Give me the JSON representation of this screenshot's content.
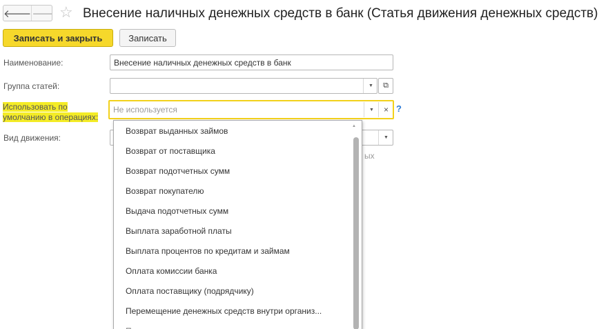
{
  "header": {
    "back_icon": "arrow-left-icon",
    "forward_icon": "arrow-right-icon",
    "favorite_icon": "star-icon",
    "title": "Внесение наличных денежных средств в банк (Статья движения денежных средств)"
  },
  "toolbar": {
    "save_close_label": "Записать и закрыть",
    "save_label": "Записать"
  },
  "form": {
    "name_label": "Наименование:",
    "name_value": "Внесение наличных денежных средств в банк",
    "group_label": "Группа статей:",
    "group_value": "",
    "default_label_line1": "Использовать по",
    "default_label_line2": "умолчанию в операциях:",
    "default_placeholder": "Не используется",
    "clear_icon_glyph": "×",
    "help_glyph": "?",
    "movement_label": "Вид движения:"
  },
  "dropdown": {
    "items": [
      "Возврат выданных займов",
      "Возврат от поставщика",
      "Возврат подотчетных сумм",
      "Возврат покупателю",
      "Выдача подотчетных сумм",
      "Выплата заработной платы",
      "Выплата процентов по кредитам и займам",
      "Оплата комиссии банка",
      "Оплата поставщику (подрядчику)",
      "Перемещение денежных средств внутри организ..."
    ]
  },
  "colors": {
    "accent": "#f6d82b",
    "highlight": "#f4ec27",
    "help": "#2d7bd6"
  }
}
